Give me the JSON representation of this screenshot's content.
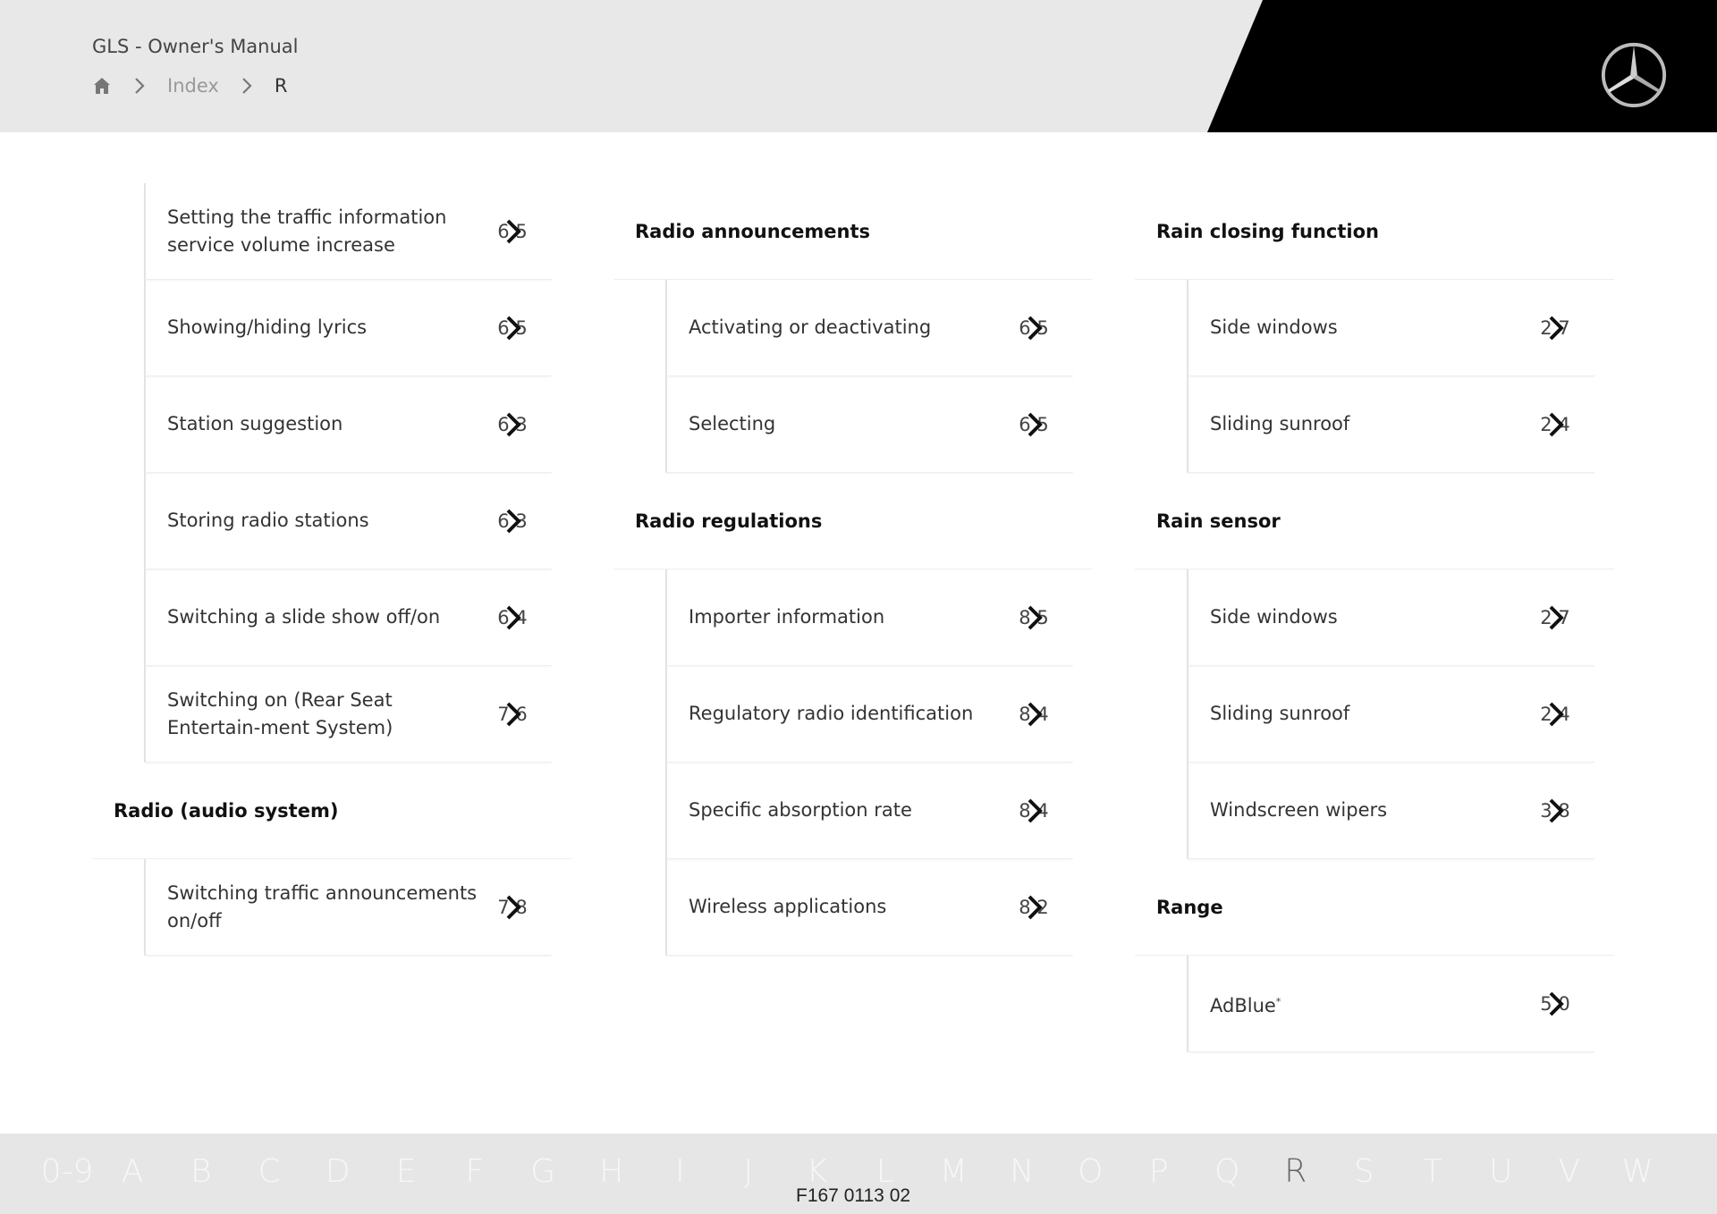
{
  "header": {
    "title": "GLS - Owner's Manual",
    "breadcrumb": {
      "home_icon": "home-icon",
      "index": "Index",
      "current": "R"
    },
    "logo": "mercedes-star-logo"
  },
  "columns": [
    {
      "groups": [
        {
          "heading": null,
          "entries": [
            {
              "label": "Setting the traffic information service volume increase",
              "page": "6 5"
            },
            {
              "label": "Showing/hiding lyrics",
              "page": "6 5"
            },
            {
              "label": "Station suggestion",
              "page": "6 3"
            },
            {
              "label": "Storing radio stations",
              "page": "6 3"
            },
            {
              "label": "Switching a slide show off/on",
              "page": "6 4"
            },
            {
              "label": "Switching on (Rear Seat Entertain-ment System)",
              "page": "7 6"
            }
          ]
        },
        {
          "heading": "Radio (audio system)",
          "entries": [
            {
              "label": "Switching traffic announcements on/off",
              "page": "7 8"
            }
          ]
        }
      ]
    },
    {
      "groups": [
        {
          "heading": "Radio announcements",
          "entries": [
            {
              "label": "Activating or deactivating",
              "page": "6 5"
            },
            {
              "label": "Selecting",
              "page": "6 5"
            }
          ]
        },
        {
          "heading": "Radio regulations",
          "entries": [
            {
              "label": "Importer information",
              "page": "8 5"
            },
            {
              "label": "Regulatory radio identification",
              "page": "8 4"
            },
            {
              "label": "Specific absorption rate",
              "page": "8 4"
            },
            {
              "label": "Wireless applications",
              "page": "8 2"
            }
          ]
        }
      ]
    },
    {
      "groups": [
        {
          "heading": "Rain closing function",
          "entries": [
            {
              "label": "Side windows",
              "page": "2 7"
            },
            {
              "label": "Sliding sunroof",
              "page": "2 4"
            }
          ]
        },
        {
          "heading": "Rain sensor",
          "entries": [
            {
              "label": "Side windows",
              "page": "2 7"
            },
            {
              "label": "Sliding sunroof",
              "page": "2 4"
            },
            {
              "label": "Windscreen wipers",
              "page": "3 8"
            }
          ]
        },
        {
          "heading": "Range",
          "entries": [
            {
              "label": "AdBlue",
              "sup": "*",
              "page": "5 0"
            }
          ]
        }
      ]
    }
  ],
  "footer": {
    "alphabet": [
      "0-9",
      "A",
      "B",
      "C",
      "D",
      "E",
      "F",
      "G",
      "H",
      "I",
      "J",
      "K",
      "L",
      "M",
      "N",
      "O",
      "P",
      "Q",
      "R",
      "S",
      "T",
      "U",
      "V",
      "W"
    ],
    "active": "R",
    "doc_id": "F167 0113 02"
  }
}
